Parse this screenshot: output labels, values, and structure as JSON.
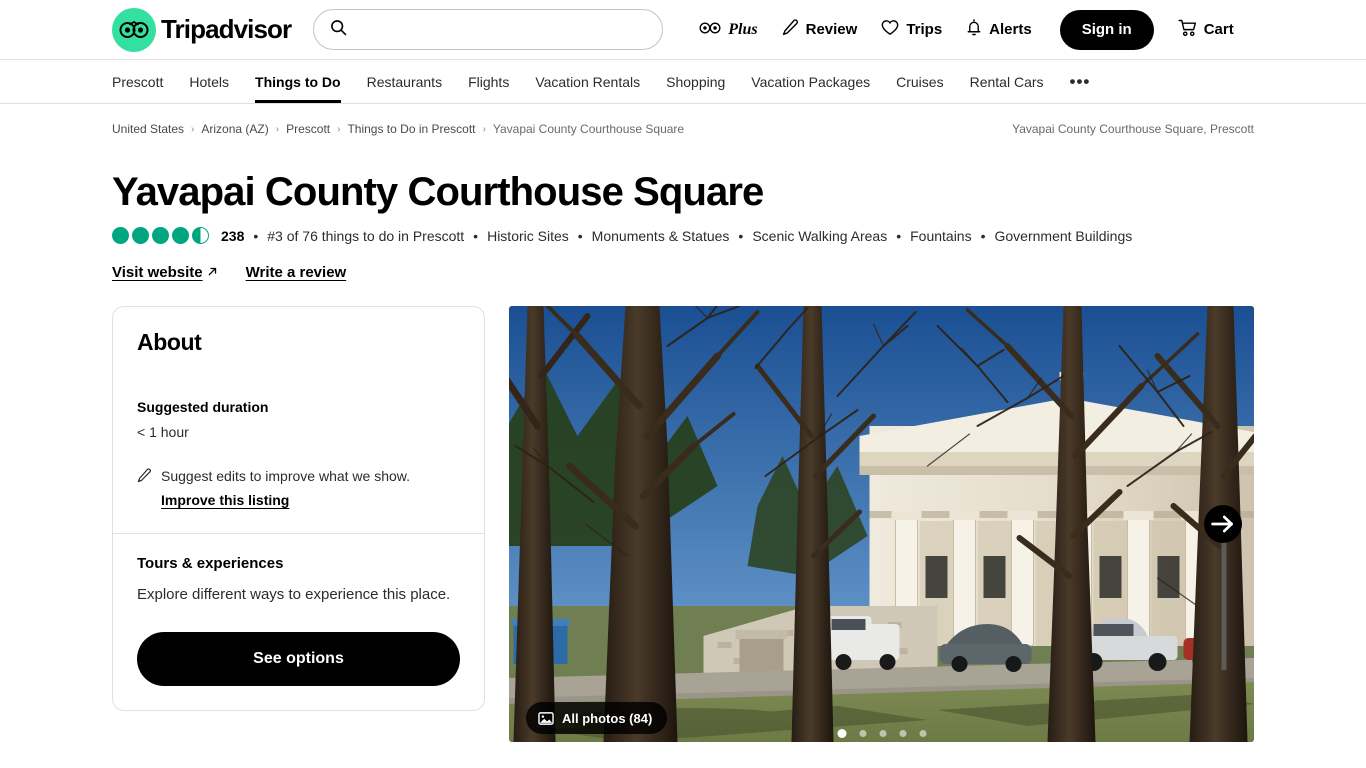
{
  "header": {
    "logo_text": "Tripadvisor",
    "logo_icon": "owl-logo-icon",
    "search": {
      "value": "",
      "placeholder": ""
    },
    "nav": [
      {
        "label": "Plus",
        "icon": "owl-plus-icon"
      },
      {
        "label": "Review",
        "icon": "pencil-icon"
      },
      {
        "label": "Trips",
        "icon": "heart-icon"
      },
      {
        "label": "Alerts",
        "icon": "bell-icon"
      }
    ],
    "sign_in": "Sign in",
    "cart": {
      "label": "Cart",
      "icon": "cart-icon"
    }
  },
  "subnav": {
    "items": [
      {
        "label": "Prescott",
        "active": false
      },
      {
        "label": "Hotels",
        "active": false
      },
      {
        "label": "Things to Do",
        "active": true
      },
      {
        "label": "Restaurants",
        "active": false
      },
      {
        "label": "Flights",
        "active": false
      },
      {
        "label": "Vacation Rentals",
        "active": false
      },
      {
        "label": "Shopping",
        "active": false
      },
      {
        "label": "Vacation Packages",
        "active": false
      },
      {
        "label": "Cruises",
        "active": false
      },
      {
        "label": "Rental Cars",
        "active": false
      }
    ],
    "more_icon": "•••"
  },
  "breadcrumb": {
    "items": [
      "United States",
      "Arizona (AZ)",
      "Prescott",
      "Things to Do in Prescott",
      "Yavapai County Courthouse Square"
    ],
    "separator": "›",
    "right_label": "Yavapai County Courthouse Square, Prescott"
  },
  "poi": {
    "title": "Yavapai County Courthouse Square",
    "rating": 4.5,
    "review_count": "238",
    "rank": "#3 of 76 things to do in Prescott",
    "categories": [
      "Historic Sites",
      "Monuments & Statues",
      "Scenic Walking Areas",
      "Fountains",
      "Government Buildings"
    ],
    "separator": "•",
    "links": [
      {
        "label": "Visit website",
        "external": true
      },
      {
        "label": "Write a review",
        "external": false
      }
    ],
    "actions": [
      {
        "name": "share-button",
        "icon": "share-icon"
      },
      {
        "name": "save-button",
        "icon": "heart-icon"
      }
    ]
  },
  "about": {
    "heading": "About",
    "duration_label": "Suggested duration",
    "duration_value": "< 1 hour",
    "suggest_text": "Suggest edits to improve what we show.",
    "suggest_link": "Improve this listing",
    "suggest_icon": "pencil-icon",
    "tours_heading": "Tours & experiences",
    "tours_text": "Explore different ways to experience this place.",
    "see_options": "See options"
  },
  "gallery": {
    "photos_badge": "All photos (84)",
    "photos_icon": "image-icon",
    "next_icon": "arrow-right-icon",
    "dot_count": 5,
    "active_dot": 0
  },
  "colors": {
    "brand_green": "#34e0a1",
    "bubble_green": "#00a680",
    "black": "#000000",
    "border": "#e0e0e0"
  }
}
